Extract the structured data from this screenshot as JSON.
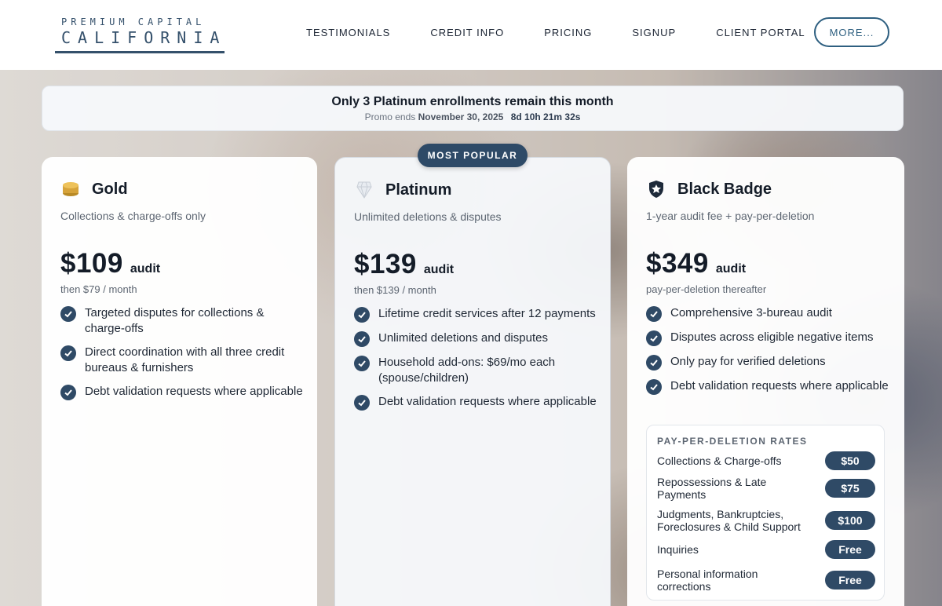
{
  "brand": {
    "line1": "PREMIUM CAPITAL",
    "line2": "CALIFORNIA"
  },
  "nav": {
    "items": [
      "TESTIMONIALS",
      "CREDIT INFO",
      "PRICING",
      "SIGNUP",
      "CLIENT PORTAL"
    ],
    "more": "MORE..."
  },
  "promo": {
    "title": "Only 3 Platinum enrollments remain this month",
    "ends_prefix": "Promo ends",
    "ends_date": "November 30, 2025",
    "countdown": "8d 10h 21m 32s"
  },
  "badge": "MOST POPULAR",
  "plans": [
    {
      "name": "Gold",
      "icon": "coin-stack-icon",
      "desc": "Collections & charge-offs only",
      "price": "$109",
      "unit": "audit",
      "note": "then $79 / month",
      "features": [
        "Targeted disputes for collections & charge-offs",
        "Direct coordination with all three credit bureaus & furnishers",
        "Debt validation requests where applicable"
      ]
    },
    {
      "name": "Platinum",
      "icon": "diamond-icon",
      "desc": "Unlimited deletions & disputes",
      "price": "$139",
      "unit": "audit",
      "note": "then $139 / month",
      "features": [
        "Lifetime credit services after 12 payments",
        "Unlimited deletions and disputes",
        "Household add-ons: $69/mo each (spouse/children)",
        "Debt validation requests where applicable"
      ]
    },
    {
      "name": "Black Badge",
      "icon": "shield-star-icon",
      "desc": "1-year audit fee + pay-per-deletion",
      "price": "$349",
      "unit": "audit",
      "note": "pay-per-deletion thereafter",
      "features": [
        "Comprehensive 3-bureau audit",
        "Disputes across eligible negative items",
        "Only pay for verified deletions",
        "Debt validation requests where applicable"
      ]
    }
  ],
  "rates": {
    "title": "PAY-PER-DELETION RATES",
    "rows": [
      {
        "label": "Collections & Charge-offs",
        "price": "$50"
      },
      {
        "label": "Repossessions & Late Payments",
        "price": "$75"
      },
      {
        "label": "Judgments, Bankruptcies, Foreclosures & Child Support",
        "price": "$100"
      },
      {
        "label": "Inquiries",
        "price": "Free"
      },
      {
        "label": "Personal information corrections",
        "price": "Free"
      }
    ]
  },
  "colors": {
    "accent": "#2f4a66",
    "brand": "#34506b",
    "gold": "#d6a33a"
  }
}
